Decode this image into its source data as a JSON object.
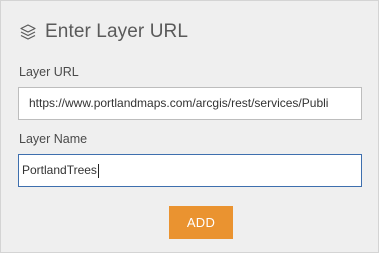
{
  "dialog": {
    "title": "Enter Layer URL",
    "icon": "layers-icon"
  },
  "layer_url": {
    "label": "Layer URL",
    "value": "https://www.portlandmaps.com/arcgis/rest/services/Publi"
  },
  "layer_name": {
    "label": "Layer Name",
    "value": "PortlandTrees"
  },
  "actions": {
    "add_label": "ADD"
  },
  "colors": {
    "accent": "#ea9330",
    "focus_border": "#3e6fae",
    "panel_background": "#efefef"
  }
}
